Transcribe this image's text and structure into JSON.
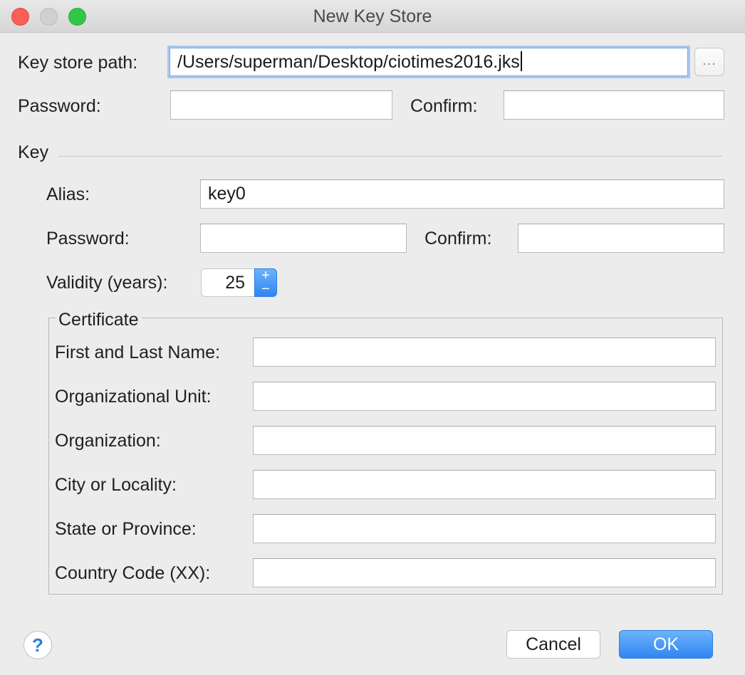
{
  "window": {
    "title": "New Key Store"
  },
  "keystore": {
    "path_label": "Key store path:",
    "path_value": "/Users/superman/Desktop/ciotimes2016.jks",
    "browse_label": "...",
    "password_label": "Password:",
    "password_value": "",
    "confirm_label": "Confirm:",
    "confirm_value": ""
  },
  "key": {
    "section_label": "Key",
    "alias_label": "Alias:",
    "alias_value": "key0",
    "password_label": "Password:",
    "password_value": "",
    "confirm_label": "Confirm:",
    "confirm_value": "",
    "validity_label": "Validity (years):",
    "validity_value": "25",
    "increment_label": "+",
    "decrement_label": "−"
  },
  "certificate": {
    "group_label": "Certificate",
    "fields": [
      {
        "label": "First and Last Name:",
        "value": ""
      },
      {
        "label": "Organizational Unit:",
        "value": ""
      },
      {
        "label": "Organization:",
        "value": ""
      },
      {
        "label": "City or Locality:",
        "value": ""
      },
      {
        "label": "State or Province:",
        "value": ""
      },
      {
        "label": "Country Code (XX):",
        "value": ""
      }
    ]
  },
  "footer": {
    "help_label": "?",
    "cancel_label": "Cancel",
    "ok_label": "OK"
  },
  "colors": {
    "accent": "#2f86f2",
    "close": "#fc5f57",
    "zoom": "#33c748"
  }
}
